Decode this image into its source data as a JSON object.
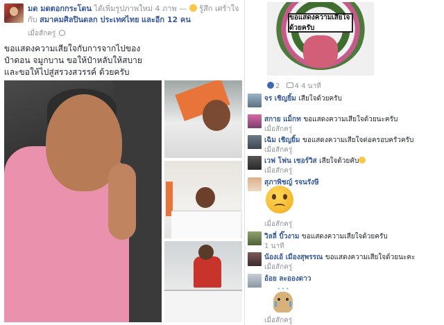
{
  "post": {
    "author": "มด มดตอกกระโดน",
    "action": "ได้เพิ่มรูปภาพใหม่ 4 ภาพ —",
    "feeling": "รู้สึก เศร้าใจ",
    "with_text": "กับ",
    "with_page": "สมาคมศิลปินดลก ประเทศไทย",
    "and_others": "และอีก 12 คน",
    "time": "เมื่อสักครู่",
    "text": "ขอแสดงความเสียใจกับการจากไปของ\nป๋าดอน จมูกบาน ขอให้ป๋าหลับให้สบาย\nและขอให้ไปสู่สรวงสวรรค์ ด้วยครับ"
  },
  "wreath": {
    "banner": "ขอแสดงความเสียใจด้วยครับ",
    "likes": "2",
    "replies": "4",
    "time": "4 นาที"
  },
  "comments": [
    {
      "name": "จร เชิญยิ้ม",
      "text": "เสียใจด้วยครับ",
      "time": "",
      "avatar": "av1"
    },
    {
      "name": "สกาย แม็กท",
      "text": "ขอแสดงความเสียใจด้วยนะครับ",
      "time": "เมื่อสักครู่",
      "avatar": "av2"
    },
    {
      "name": "เฉิม เชิญยิ้ม",
      "text": "ขอแสดงความเสียใจต่อครอบครัวครับ",
      "time": "เมื่อสักครู่",
      "avatar": "av3"
    },
    {
      "name": "เวฟ โฟน เชอร์วิส",
      "text": "เสียใจด้วยคับ",
      "time": "เมื่อสักครู่",
      "avatar": "av4"
    },
    {
      "name": "สุภาพิชญ์ รจนรังษี",
      "text": "",
      "time": "เมื่อสักครู่",
      "avatar": "av5"
    },
    {
      "name": "วิลลี่ บิ๊วงาม",
      "text": "ขอแสดงความเสียใจด้วยครับ",
      "time": "1 นาที",
      "avatar": "av6"
    },
    {
      "name": "น้องเอ้ เมืองสุพรรณ",
      "text": "ขอแสดงความเสียใจด้วยนะคะ",
      "time": "เมื่อสักครู่",
      "avatar": "av7"
    },
    {
      "name": "อ้อย ละอองดาว",
      "text": "",
      "time": "เมื่อสักครู่",
      "avatar": "av8"
    }
  ]
}
